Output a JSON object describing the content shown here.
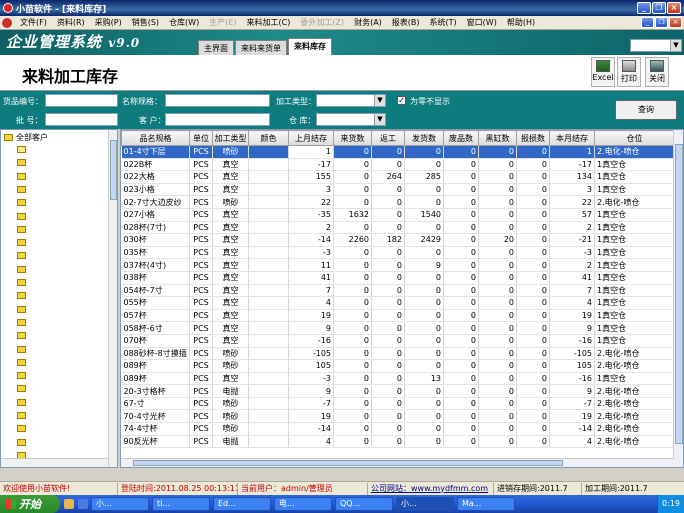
{
  "window": {
    "title": "小苗软件 - [来料库存]"
  },
  "menu": [
    "文件(F)",
    "资料(R)",
    "采购(P)",
    "销售(S)",
    "仓库(W)",
    "生产(E)",
    "来料加工(C)",
    "委外加工(Z)",
    "财务(A)",
    "报表(B)",
    "系统(T)",
    "窗口(W)",
    "帮助(H)"
  ],
  "menu_disabled": [
    "生产(E)",
    "委外加工(Z)"
  ],
  "brand": {
    "name": "企业管理系统",
    "version": "v9.0"
  },
  "tabs": [
    {
      "label": "主界面",
      "active": false
    },
    {
      "label": "来料来货单",
      "active": false
    },
    {
      "label": "来料库存",
      "active": true
    }
  ],
  "form": {
    "title": "来料加工库存"
  },
  "toolbar": {
    "excel": "Excel",
    "print": "打印",
    "close": "关闭"
  },
  "filters": {
    "item_code": "货品编号：",
    "name_spec": "名称规格：",
    "process_type": "加工类型：",
    "zero_hide": "为零不显示",
    "zero_hide_checked": true,
    "batch": "批 号：",
    "customer": "客 户：",
    "warehouse": "仓 库：",
    "query": "查询"
  },
  "tree": {
    "root": "全部客户",
    "folder_count": 24
  },
  "table": {
    "columns": [
      "品名规格",
      "单位",
      "加工类型",
      "颜色",
      "上月结存",
      "来货数",
      "返工",
      "发货数",
      "废品数",
      "黑缸数",
      "报损数",
      "本月结存",
      "仓位"
    ],
    "rows": [
      [
        "01-4寸下层",
        "PCS",
        "喷砂",
        "",
        "1",
        "0",
        "0",
        "0",
        "0",
        "0",
        "0",
        "1",
        "2.电化-喷仓"
      ],
      [
        "022B杯",
        "PCS",
        "真空",
        "",
        "-17",
        "0",
        "0",
        "0",
        "0",
        "0",
        "0",
        "-17",
        "1真空仓"
      ],
      [
        "022大格",
        "PCS",
        "真空",
        "",
        "155",
        "0",
        "264",
        "285",
        "0",
        "0",
        "0",
        "134",
        "1真空仓"
      ],
      [
        "023小格",
        "PCS",
        "真空",
        "",
        "3",
        "0",
        "0",
        "0",
        "0",
        "0",
        "0",
        "3",
        "1真空仓"
      ],
      [
        "02-7寸大边皮纱",
        "PCS",
        "喷砂",
        "",
        "22",
        "0",
        "0",
        "0",
        "0",
        "0",
        "0",
        "22",
        "2.电化-喷仓"
      ],
      [
        "027小格",
        "PCS",
        "真空",
        "",
        "-35",
        "1632",
        "0",
        "1540",
        "0",
        "0",
        "0",
        "57",
        "1真空仓"
      ],
      [
        "028杯(7寸)",
        "PCS",
        "真空",
        "",
        "2",
        "0",
        "0",
        "0",
        "0",
        "0",
        "0",
        "2",
        "1真空仓"
      ],
      [
        "030杯",
        "PCS",
        "真空",
        "",
        "-14",
        "2260",
        "182",
        "2429",
        "0",
        "20",
        "0",
        "-21",
        "1真空仓"
      ],
      [
        "035杯",
        "PCS",
        "真空",
        "",
        "-3",
        "0",
        "0",
        "0",
        "0",
        "0",
        "0",
        "-3",
        "1真空仓"
      ],
      [
        "037杯(4寸)",
        "PCS",
        "真空",
        "",
        "11",
        "0",
        "0",
        "9",
        "0",
        "0",
        "0",
        "2",
        "1真空仓"
      ],
      [
        "038杯",
        "PCS",
        "真空",
        "",
        "41",
        "0",
        "0",
        "0",
        "0",
        "0",
        "0",
        "41",
        "1真空仓"
      ],
      [
        "054杯-7寸",
        "PCS",
        "真空",
        "",
        "7",
        "0",
        "0",
        "0",
        "0",
        "0",
        "0",
        "7",
        "1真空仓"
      ],
      [
        "055杯",
        "PCS",
        "真空",
        "",
        "4",
        "0",
        "0",
        "0",
        "0",
        "0",
        "0",
        "4",
        "1真空仓"
      ],
      [
        "057杯",
        "PCS",
        "真空",
        "",
        "19",
        "0",
        "0",
        "0",
        "0",
        "0",
        "0",
        "19",
        "1真空仓"
      ],
      [
        "058杯-6寸",
        "PCS",
        "真空",
        "",
        "9",
        "0",
        "0",
        "0",
        "0",
        "0",
        "0",
        "9",
        "1真空仓"
      ],
      [
        "070杯",
        "PCS",
        "真空",
        "",
        "-16",
        "0",
        "0",
        "0",
        "0",
        "0",
        "0",
        "-16",
        "1真空仓"
      ],
      [
        "088砂杯-8寸摸插",
        "PCS",
        "喷砂",
        "",
        "-105",
        "0",
        "0",
        "0",
        "0",
        "0",
        "0",
        "-105",
        "2.电化-喷仓"
      ],
      [
        "089杯",
        "PCS",
        "喷砂",
        "",
        "105",
        "0",
        "0",
        "0",
        "0",
        "0",
        "0",
        "105",
        "2.电化-喷仓"
      ],
      [
        "089杯",
        "PCS",
        "真空",
        "",
        "-3",
        "0",
        "0",
        "13",
        "0",
        "0",
        "0",
        "-16",
        "1真空仓"
      ],
      [
        "20-3寸格杯",
        "PCS",
        "电抛",
        "",
        "9",
        "0",
        "0",
        "0",
        "0",
        "0",
        "0",
        "9",
        "2.电化-喷仓"
      ],
      [
        "67-寸",
        "PCS",
        "喷砂",
        "",
        "-7",
        "0",
        "0",
        "0",
        "0",
        "0",
        "0",
        "-7",
        "2.电化-喷仓"
      ],
      [
        "70-4寸光杯",
        "PCS",
        "喷砂",
        "",
        "19",
        "0",
        "0",
        "0",
        "0",
        "0",
        "0",
        "19",
        "2.电化-喷仓"
      ],
      [
        "74-4寸杯",
        "PCS",
        "喷砂",
        "",
        "-14",
        "0",
        "0",
        "0",
        "0",
        "0",
        "0",
        "-14",
        "2.电化-喷仓"
      ],
      [
        "90反光杯",
        "PCS",
        "电抛",
        "",
        "4",
        "0",
        "0",
        "0",
        "0",
        "0",
        "0",
        "4",
        "2.电化-喷仓"
      ]
    ]
  },
  "status": {
    "welcome": "欢迎使用小苗软件!",
    "login_time": "登陆时间:2011.08.25 00:13:11",
    "user": "当前用户：admin/管理员",
    "website": "公司网站：www.mydfmm.com",
    "stock_period": "进销存期间:2011.7",
    "process_period": "加工期间:2011.7"
  },
  "taskbar": {
    "start": "开始",
    "tasks": [
      "小...",
      "ti...",
      "Ed...",
      "电...",
      "QQ...",
      "小...",
      "Ma..."
    ],
    "active_task": 5,
    "clock": "0:19"
  }
}
